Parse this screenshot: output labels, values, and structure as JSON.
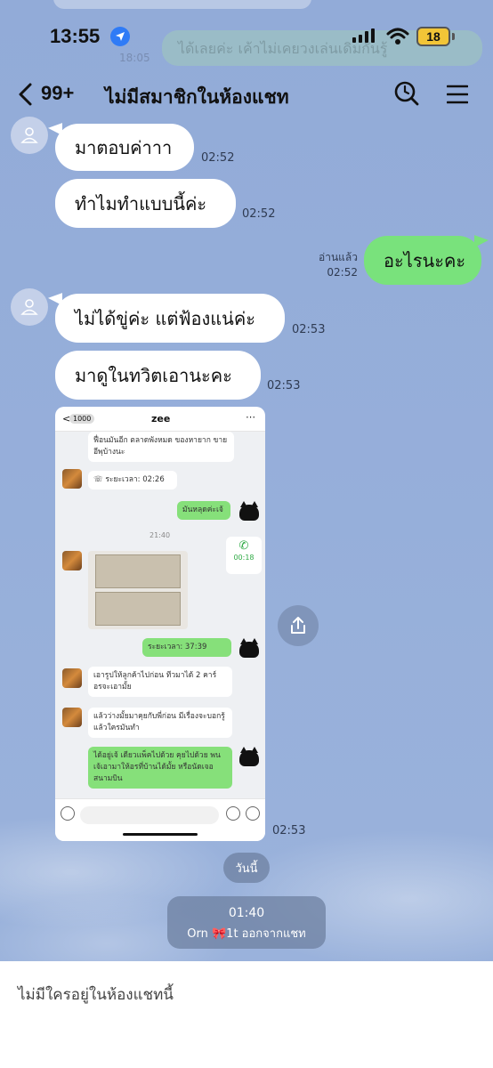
{
  "status_bar": {
    "time": "13:55",
    "battery": "18"
  },
  "background_ghost": {
    "text": "ได้เลยค่ะ เค้าไม่เคยวงเล่นเดิมกันรู้",
    "time": "18:05"
  },
  "header": {
    "unread_count": "99+",
    "title": "ไม่มีสมาชิกในห้องแชท"
  },
  "messages": [
    {
      "text": "มาตอบค่าาา",
      "time": "02:52"
    },
    {
      "text": "ทำไมทำแบบนี้ค่ะ",
      "time": "02:52"
    },
    {
      "text": "อะไรนะคะ",
      "time": "02:52",
      "read": "อ่านแล้ว"
    },
    {
      "text": "ไม่ได้ขู่ค่ะ แต่ฟ้องแน่ค่ะ",
      "time": "02:53"
    },
    {
      "text": "มาดูในทวิตเอานะคะ",
      "time": "02:53"
    },
    {
      "time": "02:53"
    }
  ],
  "shared_screenshot": {
    "back_count": "1000",
    "chat_name": "zee",
    "top_text": "ฟื่อนมันอีก ตลาดพังหมด ของหายาก ขายอีพุบ้างนะ",
    "call1": "ระยะเวลา: 02:26",
    "sent1": "มันหลุดค่ะเจ้",
    "divider_time": "21:40",
    "call_time": "00:18",
    "call2": "ระยะเวลา: 37:39",
    "recv1": "เอารูปให้ลูกค้าไปก่อน ทีวมาได้ 2 คาร์ อรจะเอามั้ย",
    "recv2": "แล้วว่างมั้ยมาคุยกับพี่ก่อน มีเรื่องจะบอกรู้แล้วใครมันทำ",
    "sent2": "ได้อยู่เจ้ เดียวแพ็คไปด้วย คุยไปด้วย พนเจ้เอามาให้อรที่บ้านได้มั้ย หรือนัดเจอสนามบิน"
  },
  "system": {
    "day": "วันนี้",
    "event_time": "01:40",
    "event_text": "Orn 🎀1t ออกจากแชท"
  },
  "footer": {
    "text": "ไม่มีใครอยู่ในห้องแชทนี้"
  }
}
